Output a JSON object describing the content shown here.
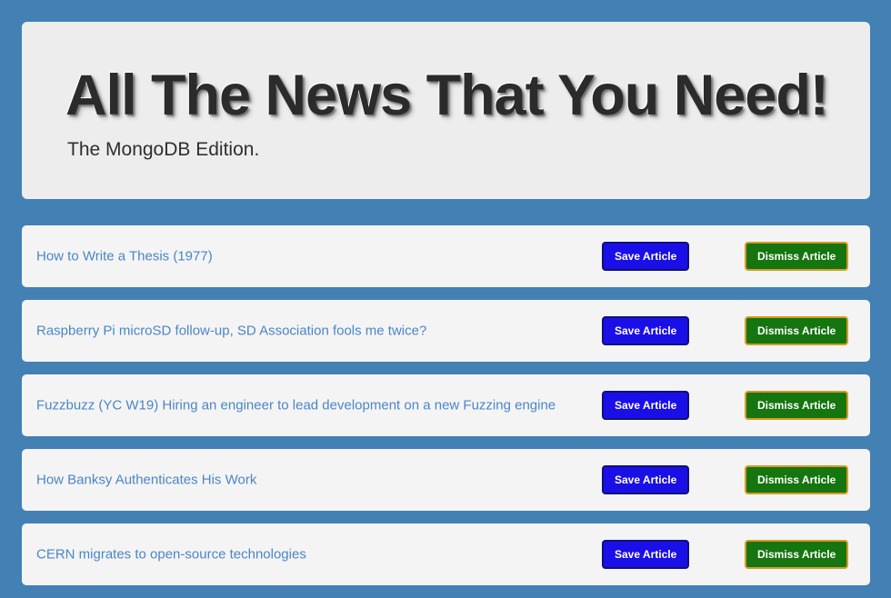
{
  "theme": {
    "page_background": "#4380b4",
    "card_background": "#f4f4f4",
    "jumbotron_background": "#ededed",
    "link_color": "#4a86c8",
    "save_button_background": "#1b0fe8",
    "save_button_border": "#10107a",
    "dismiss_button_background": "#15750f",
    "dismiss_button_border": "#d79a23"
  },
  "header": {
    "title": "All The News That You Need!",
    "subtitle": "The MongoDB Edition."
  },
  "buttons": {
    "save_label": "Save Article",
    "dismiss_label": "Dismiss Article"
  },
  "articles": [
    {
      "title": "How to Write a Thesis (1977)"
    },
    {
      "title": "Raspberry Pi microSD follow-up, SD Association fools me twice?"
    },
    {
      "title": "Fuzzbuzz (YC W19) Hiring an engineer to lead development on a new Fuzzing engine"
    },
    {
      "title": "How Banksy Authenticates His Work"
    },
    {
      "title": "CERN migrates to open-source technologies"
    }
  ]
}
